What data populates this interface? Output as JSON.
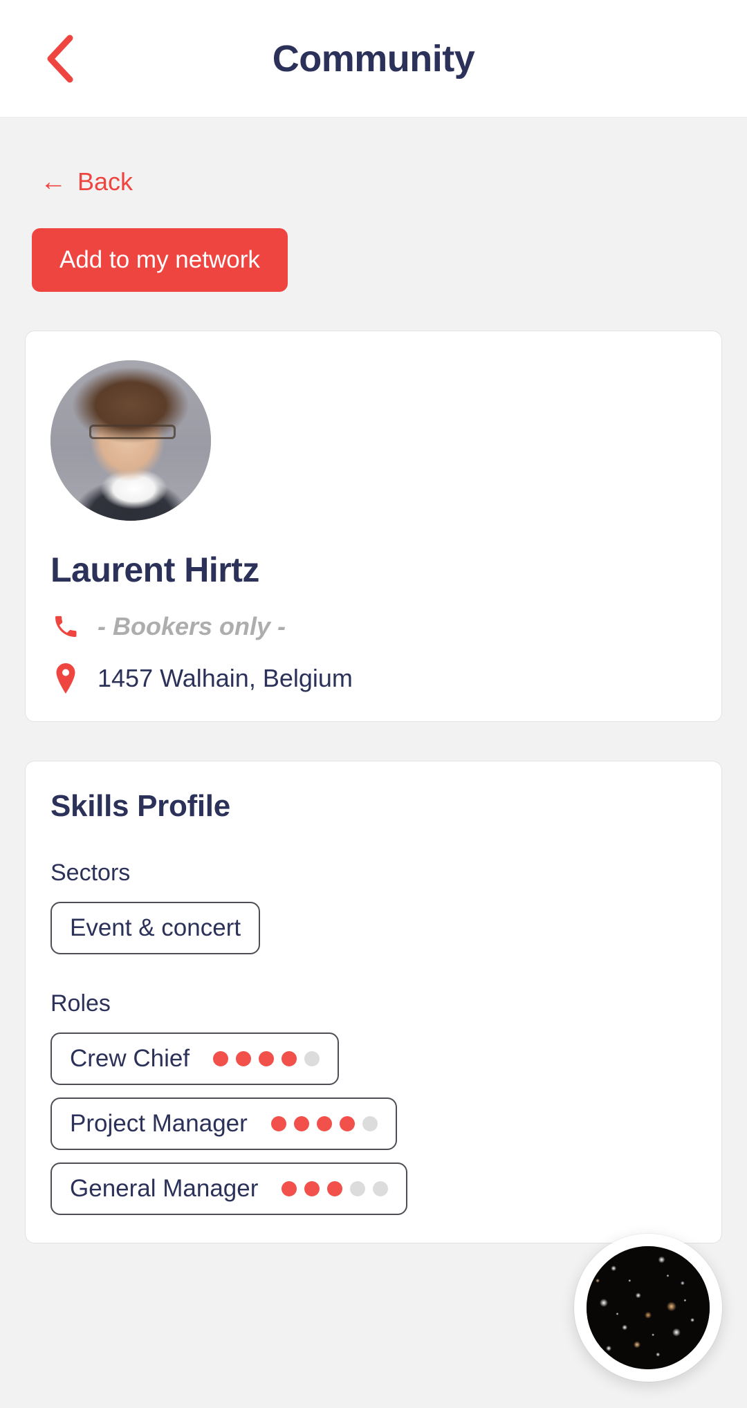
{
  "header": {
    "title": "Community",
    "back_icon": "chevron-left-icon"
  },
  "nav": {
    "back_label": "Back",
    "back_arrow": "←"
  },
  "actions": {
    "add_to_network_label": "Add to my network"
  },
  "profile": {
    "avatar_alt": "profile-photo",
    "name": "Laurent Hirtz",
    "phone_icon": "phone-icon",
    "phone_value": "- Bookers only -",
    "location_icon": "location-pin-icon",
    "location_value": "1457 Walhain, Belgium"
  },
  "skills": {
    "title": "Skills Profile",
    "sectors_label": "Sectors",
    "sectors": [
      {
        "label": "Event & concert"
      }
    ],
    "roles_label": "Roles",
    "roles": [
      {
        "label": "Crew Chief",
        "rating": 4,
        "max": 5
      },
      {
        "label": "Project Manager",
        "rating": 4,
        "max": 5
      },
      {
        "label": "General Manager",
        "rating": 3,
        "max": 5
      }
    ]
  },
  "fab": {
    "icon": "galaxy-avatar-icon"
  },
  "colors": {
    "accent": "#ef4540",
    "dot_on": "#f2504b",
    "dot_off": "#dcdcdc",
    "text_dark": "#2b3159",
    "muted": "#adadad",
    "page_bg": "#f2f2f2"
  }
}
